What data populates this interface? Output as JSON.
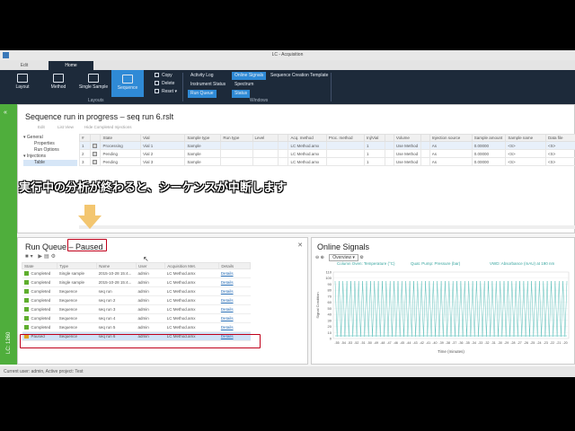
{
  "window": {
    "title": "LC - Acquisition"
  },
  "ribbon_tabs": [
    "Edit",
    "Home"
  ],
  "ribbon": {
    "layout": "Layout",
    "method": "Method",
    "single_sample": "Single Sample",
    "sequence": "Sequence",
    "copy": "Copy",
    "delete": "Delete",
    "reset": "Reset",
    "layouts_group": "Layouts",
    "windows_group": "Windows",
    "activity_log": "Activity Log",
    "online_signals": "Online Signals",
    "sequence_creation_template": "Sequence Creation Template",
    "instrument_status": "Instrument Status",
    "spectrum": "Spectrum",
    "run_queue": "Run Queue",
    "status": "Status"
  },
  "rail": {
    "label": "LC: 1260"
  },
  "sequence_panel": {
    "title": "Sequence run in progress – seq run 6.rslt",
    "toolbar": [
      "Edit",
      "List View",
      "Hide Completed Injections"
    ],
    "tree": [
      {
        "label": "General",
        "level": 1
      },
      {
        "label": "Properties",
        "level": 2
      },
      {
        "label": "Run Options",
        "level": 2
      },
      {
        "label": "Injections",
        "level": 1
      },
      {
        "label": "Table",
        "level": 2
      }
    ],
    "columns": [
      "#",
      "",
      "State",
      "Vial",
      "Sample type",
      "Run type",
      "Level",
      "",
      "Acq. method",
      "Proc. method",
      "Inj/Vial",
      "",
      "Volume",
      "",
      "Injection source",
      "Sample amount",
      "Sample name",
      "Data file"
    ],
    "rows": [
      [
        "1",
        "Processing",
        "Vial 1",
        "Sample",
        "",
        "",
        "LC Method.amx",
        "",
        "1",
        "Use Method",
        "As",
        "0.00000",
        "<S>",
        "<S>"
      ],
      [
        "2",
        "Pending",
        "Vial 2",
        "Sample",
        "",
        "",
        "LC Method.amx",
        "",
        "1",
        "Use Method",
        "As",
        "0.00000",
        "<S>",
        "<S>"
      ],
      [
        "3",
        "Pending",
        "Vial 3",
        "Sample",
        "",
        "",
        "LC Method.amx",
        "",
        "1",
        "Use Method",
        "As",
        "0.00000",
        "<S>",
        "<S>"
      ]
    ]
  },
  "banner": {
    "text": "実行中の分析が終わると、シーケンスが中断します"
  },
  "run_queue": {
    "title": "Run Queue – Paused",
    "columns": [
      "State",
      "Type",
      "Name",
      "User",
      "Acquisition Met.",
      "Details"
    ],
    "rows": [
      {
        "state": "Completed",
        "type": "Single sample",
        "name": "2015-10-28 15:4...",
        "user": "admin",
        "method": "LC Method.amx",
        "details": "Details",
        "status": "done"
      },
      {
        "state": "Completed",
        "type": "Single sample",
        "name": "2015-10-28 15:4...",
        "user": "admin",
        "method": "LC Method.amx",
        "details": "Details",
        "status": "done"
      },
      {
        "state": "Completed",
        "type": "Sequence",
        "name": "seq run",
        "user": "admin",
        "method": "LC Method.amx",
        "details": "Details",
        "status": "done"
      },
      {
        "state": "Completed",
        "type": "Sequence",
        "name": "seq run 2",
        "user": "admin",
        "method": "LC Method.amx",
        "details": "Details",
        "status": "done"
      },
      {
        "state": "Completed",
        "type": "Sequence",
        "name": "seq run 3",
        "user": "admin",
        "method": "LC Method.amx",
        "details": "Details",
        "status": "done"
      },
      {
        "state": "Completed",
        "type": "Sequence",
        "name": "seq run 4",
        "user": "admin",
        "method": "LC Method.amx",
        "details": "Details",
        "status": "done"
      },
      {
        "state": "Completed",
        "type": "Sequence",
        "name": "seq run 5",
        "user": "admin",
        "method": "LC Method.amx",
        "details": "Details",
        "status": "done"
      },
      {
        "state": "Paused",
        "type": "Sequence",
        "name": "seq run 6",
        "user": "admin",
        "method": "LC Method.amx",
        "details": "Details",
        "status": "paused"
      }
    ]
  },
  "online_signals": {
    "title": "Online Signals",
    "mode": "Overview",
    "channels": [
      "Column Oven: Temperature (°C)",
      "Quat. Pump: Pressure (bar)",
      "VWD: Absorbance (mAU) at 190 nm"
    ],
    "y_ticks": [
      "110",
      "100",
      "90",
      "80",
      "70",
      "60",
      "50",
      "40",
      "30",
      "20",
      "10",
      "0"
    ],
    "y_label": "Signal Condition",
    "x_ticks": [
      "-55",
      "-54",
      "-53",
      "-52",
      "-51",
      "-50",
      "-49",
      "-48",
      "-47",
      "-46",
      "-45",
      "-44",
      "-43",
      "-42",
      "-41",
      "-40",
      "-39",
      "-38",
      "-37",
      "-36",
      "-35",
      "-34",
      "-33",
      "-32",
      "-31",
      "-30",
      "-29",
      "-28",
      "-27",
      "-26",
      "-25",
      "-24",
      "-23",
      "-22",
      "-21",
      "-20"
    ],
    "x_label": "Time (minutes)"
  },
  "status_bar": {
    "text": "Current user: admin, Active project: Test"
  },
  "colors": {
    "ribbon_bg": "#1d2a3a",
    "accent": "#2f8ad6",
    "rail_green": "#4fae3c",
    "highlight_red": "#c0001a",
    "signal_teal": "#4ab8b2"
  }
}
